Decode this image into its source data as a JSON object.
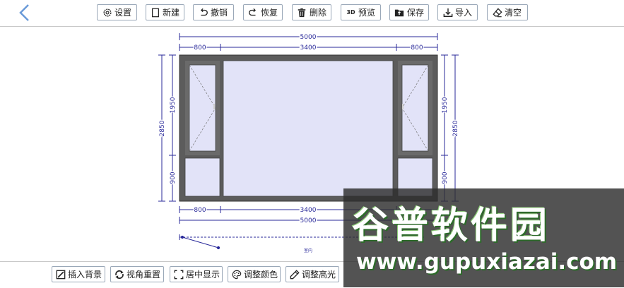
{
  "toolbar": {
    "back_icon": "chevron-left-icon",
    "buttons": [
      {
        "name": "settings",
        "label": "设置",
        "icon": "gear-icon"
      },
      {
        "name": "new",
        "label": "新建",
        "icon": "new-file-icon"
      },
      {
        "name": "undo",
        "label": "撤销",
        "icon": "undo-icon"
      },
      {
        "name": "redo",
        "label": "恢复",
        "icon": "redo-icon"
      },
      {
        "name": "delete",
        "label": "删除",
        "icon": "trash-icon"
      },
      {
        "name": "preview",
        "label": "预览",
        "icon": "3d-icon",
        "icon_text": "3D"
      },
      {
        "name": "save",
        "label": "保存",
        "icon": "save-folder-icon"
      },
      {
        "name": "import",
        "label": "导入",
        "icon": "import-icon"
      },
      {
        "name": "clear",
        "label": "清空",
        "icon": "eraser-icon"
      }
    ]
  },
  "drawing": {
    "dimensions": {
      "total_width": "5000",
      "top_segments": [
        "800",
        "3400",
        "800"
      ],
      "bottom_segments": [
        "800",
        "3400"
      ],
      "bottom_total": "5000",
      "total_height": "2850",
      "upper_height": "1950",
      "lower_height": "900"
    },
    "interior_label": "室内",
    "colors": {
      "frame": "#5c5c5c",
      "glass": "#e2e3f8",
      "dimension": "#2a2a9a"
    }
  },
  "bottom_toolbar": {
    "buttons": [
      {
        "name": "insert-background",
        "label": "插入背景",
        "icon": "image-icon"
      },
      {
        "name": "reset-view",
        "label": "视角重置",
        "icon": "rotate-icon"
      },
      {
        "name": "center-display",
        "label": "居中显示",
        "icon": "center-icon"
      },
      {
        "name": "adjust-color",
        "label": "调整颜色",
        "icon": "palette-icon"
      },
      {
        "name": "adjust-highlight",
        "label": "调整高光",
        "icon": "pen-icon"
      }
    ]
  },
  "watermark": {
    "title": "谷普软件园",
    "url": "www.gupuxiazai.com"
  }
}
